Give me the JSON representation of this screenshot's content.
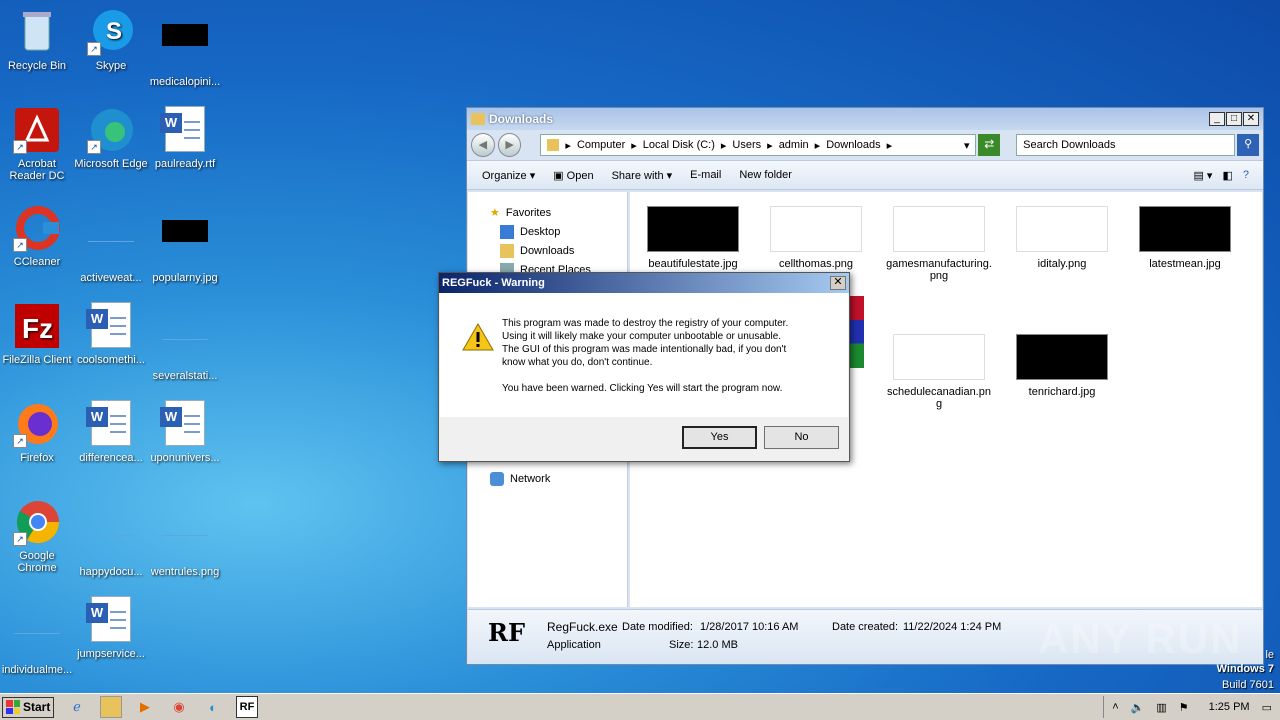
{
  "desktop": {
    "icons": [
      {
        "label": "Recycle Bin"
      },
      {
        "label": "Skype"
      },
      {
        "label": "medicalopini..."
      },
      {
        "label": "Acrobat Reader DC"
      },
      {
        "label": "Microsoft Edge"
      },
      {
        "label": "paulready.rtf"
      },
      {
        "label": "CCleaner"
      },
      {
        "label": "activeweat..."
      },
      {
        "label": "popularny.jpg"
      },
      {
        "label": "FileZilla Client"
      },
      {
        "label": "coolsomethi..."
      },
      {
        "label": "severalstati..."
      },
      {
        "label": "Firefox"
      },
      {
        "label": "differencea..."
      },
      {
        "label": "uponunivers..."
      },
      {
        "label": "Google Chrome"
      },
      {
        "label": "happydocu..."
      },
      {
        "label": "wentrules.png"
      },
      {
        "label": "individualme..."
      },
      {
        "label": "jumpservice..."
      }
    ],
    "watermark": {
      "line1": "le",
      "line2": "Windows 7",
      "line3": "Build 7601"
    },
    "brand": "ANY RUN"
  },
  "explorer": {
    "title": "Downloads",
    "breadcrumb": [
      "Computer",
      "Local Disk (C:)",
      "Users",
      "admin",
      "Downloads"
    ],
    "search_placeholder": "Search Downloads",
    "toolbar": {
      "organize": "Organize",
      "open": "Open",
      "share": "Share with",
      "email": "E-mail",
      "newfolder": "New folder"
    },
    "nav": {
      "favorites": "Favorites",
      "desktop": "Desktop",
      "downloads": "Downloads",
      "recent": "Recent Places",
      "network": "Network"
    },
    "files": [
      {
        "name": "beautifulestate.jpg"
      },
      {
        "name": "cellthomas.png"
      },
      {
        "name": "gamesmanufacturing.png"
      },
      {
        "name": "iditaly.png"
      },
      {
        "name": "latestmean.jpg"
      },
      {
        "name": "schedulecanadian.png"
      },
      {
        "name": "tenrichard.jpg"
      }
    ],
    "details": {
      "filename": "RegFuck.exe",
      "type": "Application",
      "modified_label": "Date modified:",
      "modified": "1/28/2017 10:16 AM",
      "size_label": "Size:",
      "size": "12.0 MB",
      "created_label": "Date created:",
      "created": "11/22/2024 1:24 PM",
      "icon_text": "RF"
    }
  },
  "dialog": {
    "title": "REGFuck - Warning",
    "line1": "This program was made to destroy the registry of your computer.",
    "line2": "Using it will likely make your computer unbootable or unusable.",
    "line3": "The GUI of this program was made intentionally bad, if you don't",
    "line4": "know what you do, don't continue.",
    "line5": "You have been warned. Clicking Yes will start the program now.",
    "yes": "Yes",
    "no": "No"
  },
  "taskbar": {
    "start": "Start",
    "clock": "1:25 PM",
    "rf_label": "RF"
  }
}
